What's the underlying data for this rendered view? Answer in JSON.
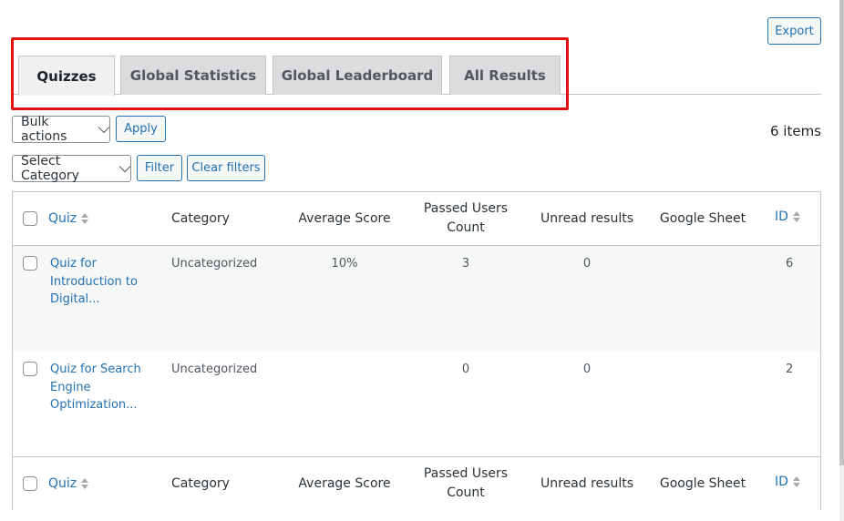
{
  "header": {
    "export_label": "Export"
  },
  "tabs": [
    {
      "label": "Quizzes",
      "active": true
    },
    {
      "label": "Global Statistics",
      "active": false
    },
    {
      "label": "Global Leaderboard",
      "active": false
    },
    {
      "label": "All Results",
      "active": false
    }
  ],
  "toolbar": {
    "bulk_actions": "Bulk actions",
    "apply": "Apply",
    "select_category": "Select Category",
    "filter": "Filter",
    "clear_filters": "Clear filters",
    "items_count": "6 items"
  },
  "table": {
    "columns": [
      "Quiz",
      "Category",
      "Average Score",
      "Passed Users Count",
      "Unread results",
      "Google Sheet",
      "ID"
    ],
    "rows": [
      {
        "quiz": "Quiz for Introduction to Digital...",
        "category": "Uncategorized",
        "average_score": "10%",
        "passed_users": "3",
        "unread": "0",
        "google_sheet": "",
        "id": "6"
      },
      {
        "quiz": "Quiz for Search Engine Optimization...",
        "category": "Uncategorized",
        "average_score": "",
        "passed_users": "0",
        "unread": "0",
        "google_sheet": "",
        "id": "2"
      }
    ]
  }
}
